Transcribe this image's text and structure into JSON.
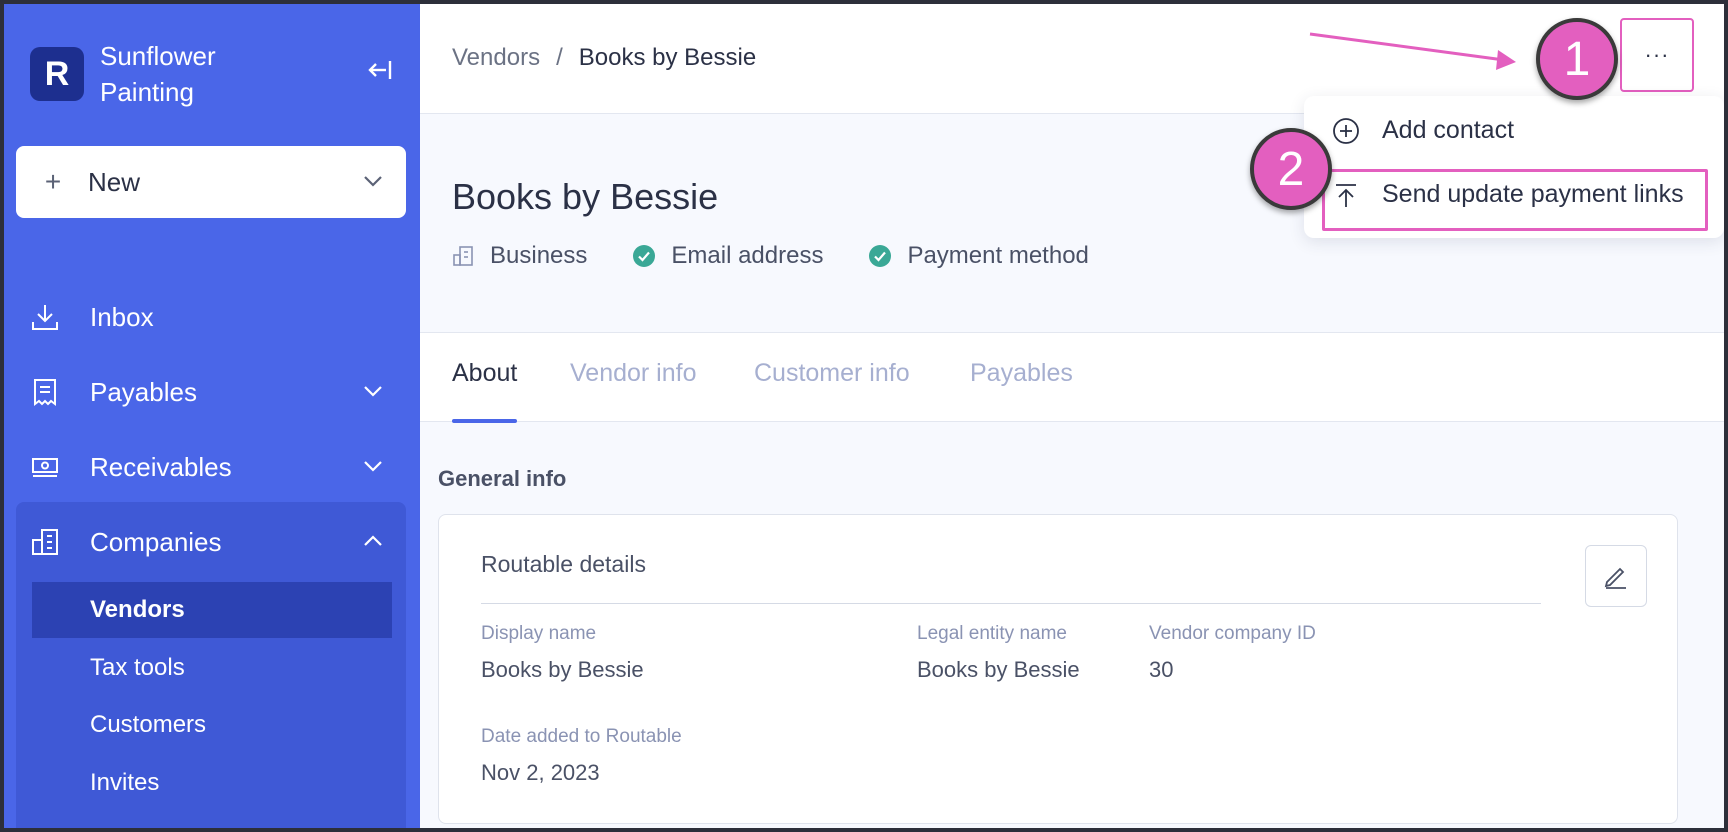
{
  "sidebar": {
    "brand": {
      "name": "Sunflower Painting",
      "logo_letter": "R"
    },
    "new_button": {
      "label": "New"
    },
    "items": [
      {
        "label": "Inbox",
        "icon": "download-tray-icon"
      },
      {
        "label": "Payables",
        "icon": "receipt-icon"
      },
      {
        "label": "Receivables",
        "icon": "money-icon"
      },
      {
        "label": "Companies",
        "icon": "building-icon"
      }
    ],
    "sub_items": [
      {
        "label": "Vendors",
        "active": true
      },
      {
        "label": "Tax tools"
      },
      {
        "label": "Customers"
      },
      {
        "label": "Invites"
      }
    ]
  },
  "breadcrumb": {
    "parent": "Vendors",
    "separator": "/",
    "current": "Books by Bessie"
  },
  "more_button": {
    "label": "···"
  },
  "vendor": {
    "title": "Books by Bessie",
    "badges": [
      "Business",
      "Email address",
      "Payment method"
    ]
  },
  "tabs": [
    "About",
    "Vendor info",
    "Customer info",
    "Payables"
  ],
  "section_title": "General info",
  "card": {
    "title": "Routable details",
    "fields": {
      "display_name": {
        "label": "Display name",
        "value": "Books by Bessie"
      },
      "legal_entity_name": {
        "label": "Legal entity name",
        "value": "Books by Bessie"
      },
      "vendor_company_id": {
        "label": "Vendor company ID",
        "value": "30"
      },
      "date_added": {
        "label": "Date added to Routable",
        "value": "Nov 2, 2023"
      }
    }
  },
  "menu": {
    "items": [
      {
        "label": "Add contact",
        "icon": "plus-circle-icon"
      },
      {
        "label": "Send update payment links",
        "icon": "upload-icon"
      }
    ]
  },
  "annotations": {
    "step1": "1",
    "step2": "2"
  },
  "colors": {
    "sidebar": "#4a66e8",
    "accent": "#e35fbf",
    "success": "#3aa896"
  }
}
